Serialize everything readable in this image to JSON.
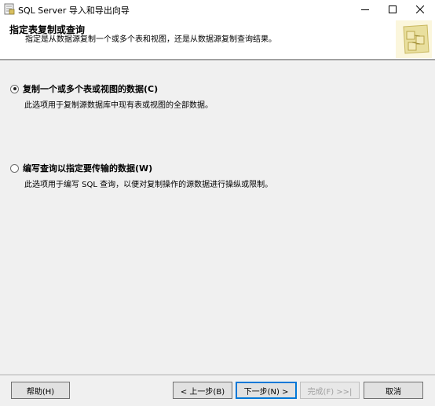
{
  "window": {
    "title": "SQL Server 导入和导出向导"
  },
  "header": {
    "title": "指定表复制或查询",
    "description": "指定是从数据源复制一个或多个表和视图，还是从数据源复制查询结果。"
  },
  "options": [
    {
      "label": "复制一个或多个表或视图的数据(C)",
      "description": "此选项用于复制源数据库中现有表或视图的全部数据。",
      "selected": true
    },
    {
      "label": "编写查询以指定要传输的数据(W)",
      "description": "此选项用于编写 SQL 查询，以便对复制操作的源数据进行操纵或限制。",
      "selected": false
    }
  ],
  "buttons": {
    "help": "帮助(H)",
    "back": "< 上一步(B)",
    "next": "下一步(N) >",
    "finish": "完成(F) >>|",
    "cancel": "取消"
  },
  "colors": {
    "window_bg": "#f0f0f0",
    "header_bg": "#ffffff",
    "default_button_border": "#0078d7",
    "disabled_text": "#a0a0a0"
  }
}
